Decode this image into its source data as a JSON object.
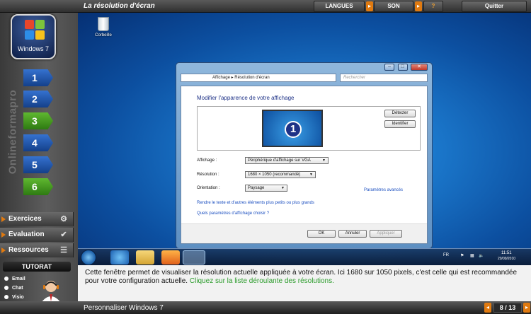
{
  "topbar": {
    "title": "La résolution d'écran",
    "langues": "LANGUES",
    "son": "SON",
    "help": "?",
    "quit": "Quitter"
  },
  "sidebar": {
    "logo_text": "Windows 7",
    "brand": "Onlineformapro",
    "steps": [
      "1",
      "2",
      "3",
      "4",
      "5",
      "6"
    ],
    "active_step": "3",
    "menu": [
      {
        "label": "Exercices",
        "icon": "gear-icon"
      },
      {
        "label": "Evaluation",
        "icon": "checkmark-icon"
      },
      {
        "label": "Ressources",
        "icon": "list-icon"
      }
    ],
    "tutorat": "TUTORAT",
    "contacts": [
      "Email",
      "Chat",
      "Visio"
    ]
  },
  "desktop": {
    "recycle_bin": "Corbeille",
    "window": {
      "breadcrumb": "Affichage  ▸  Résolution d'écran",
      "search_placeholder": "Rechercher",
      "heading": "Modifier l'apparence de votre affichage",
      "monitor_number": "1",
      "detect": "Détecter",
      "identify": "Identifier",
      "display_label": "Affichage :",
      "display_value": "Périphérique d'affichage sur VGA",
      "resolution_label": "Résolution :",
      "resolution_value": "1680 × 1050 (recommandé)",
      "orientation_label": "Orientation :",
      "orientation_value": "Paysage",
      "advanced": "Paramètres avancés",
      "text_size_link": "Rendre le texte et d'autres éléments plus petits ou plus grands",
      "which_settings_link": "Quels paramètres d'affichage choisir ?",
      "ok": "OK",
      "cancel": "Annuler",
      "apply": "Appliquer"
    },
    "taskbar": {
      "lang": "FR",
      "time": "11:51",
      "date": "20/09/2010"
    }
  },
  "info": {
    "text": "Cette fenêtre permet de visualiser la résolution actuelle appliquée à votre écran. Ici 1680 sur 1050 pixels, c'est celle qui est recommandée pour votre configuration actuelle. ",
    "highlight": "Cliquez sur la liste déroulante des résolutions."
  },
  "bottom": {
    "lesson": "Personnaliser Windows 7",
    "page": "8 / 13"
  }
}
